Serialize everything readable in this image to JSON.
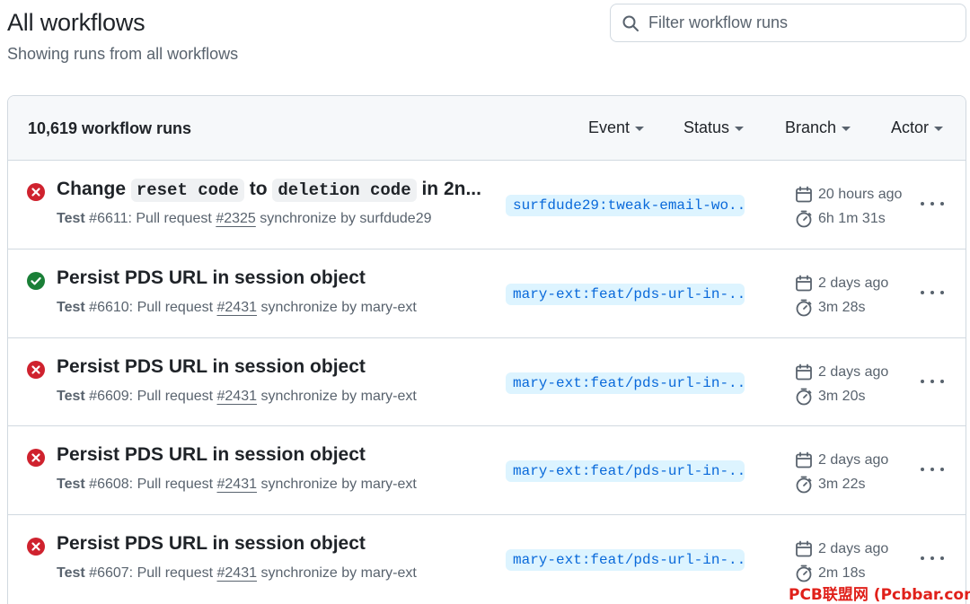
{
  "header": {
    "title": "All workflows",
    "subtitle": "Showing runs from all workflows"
  },
  "search": {
    "placeholder": "Filter workflow runs"
  },
  "runs_header": {
    "count": "10,619 workflow runs",
    "filters": [
      "Event",
      "Status",
      "Branch",
      "Actor"
    ]
  },
  "colors": {
    "failure": "#cf222e",
    "success": "#1a7f37",
    "branch_bg": "#ddf4ff",
    "branch_fg": "#0969da"
  },
  "runs": [
    {
      "status": "failure",
      "title_parts": [
        "Change ",
        "reset code",
        " to ",
        "deletion code",
        " in 2n..."
      ],
      "workflow": "Test",
      "run_number": "#6611",
      "event": ": Pull request ",
      "pr": "#2325",
      "action": " synchronize by surfdude29",
      "branch": "surfdude29:tweak-email-wo...",
      "when": "20 hours ago",
      "duration": "6h 1m 31s"
    },
    {
      "status": "success",
      "title": "Persist PDS URL in session object",
      "workflow": "Test",
      "run_number": "#6610",
      "event": ": Pull request ",
      "pr": "#2431",
      "action": " synchronize by mary-ext",
      "branch": "mary-ext:feat/pds-url-in-...",
      "when": "2 days ago",
      "duration": "3m 28s"
    },
    {
      "status": "failure",
      "title": "Persist PDS URL in session object",
      "workflow": "Test",
      "run_number": "#6609",
      "event": ": Pull request ",
      "pr": "#2431",
      "action": " synchronize by mary-ext",
      "branch": "mary-ext:feat/pds-url-in-...",
      "when": "2 days ago",
      "duration": "3m 20s"
    },
    {
      "status": "failure",
      "title": "Persist PDS URL in session object",
      "workflow": "Test",
      "run_number": "#6608",
      "event": ": Pull request ",
      "pr": "#2431",
      "action": " synchronize by mary-ext",
      "branch": "mary-ext:feat/pds-url-in-...",
      "when": "2 days ago",
      "duration": "3m 22s"
    },
    {
      "status": "failure",
      "title": "Persist PDS URL in session object",
      "workflow": "Test",
      "run_number": "#6607",
      "event": ": Pull request ",
      "pr": "#2431",
      "action": " synchronize by mary-ext",
      "branch": "mary-ext:feat/pds-url-in-...",
      "when": "2 days ago",
      "duration": "2m 18s"
    }
  ],
  "watermark": "PCB联盟网 (Pcbbar.com)"
}
